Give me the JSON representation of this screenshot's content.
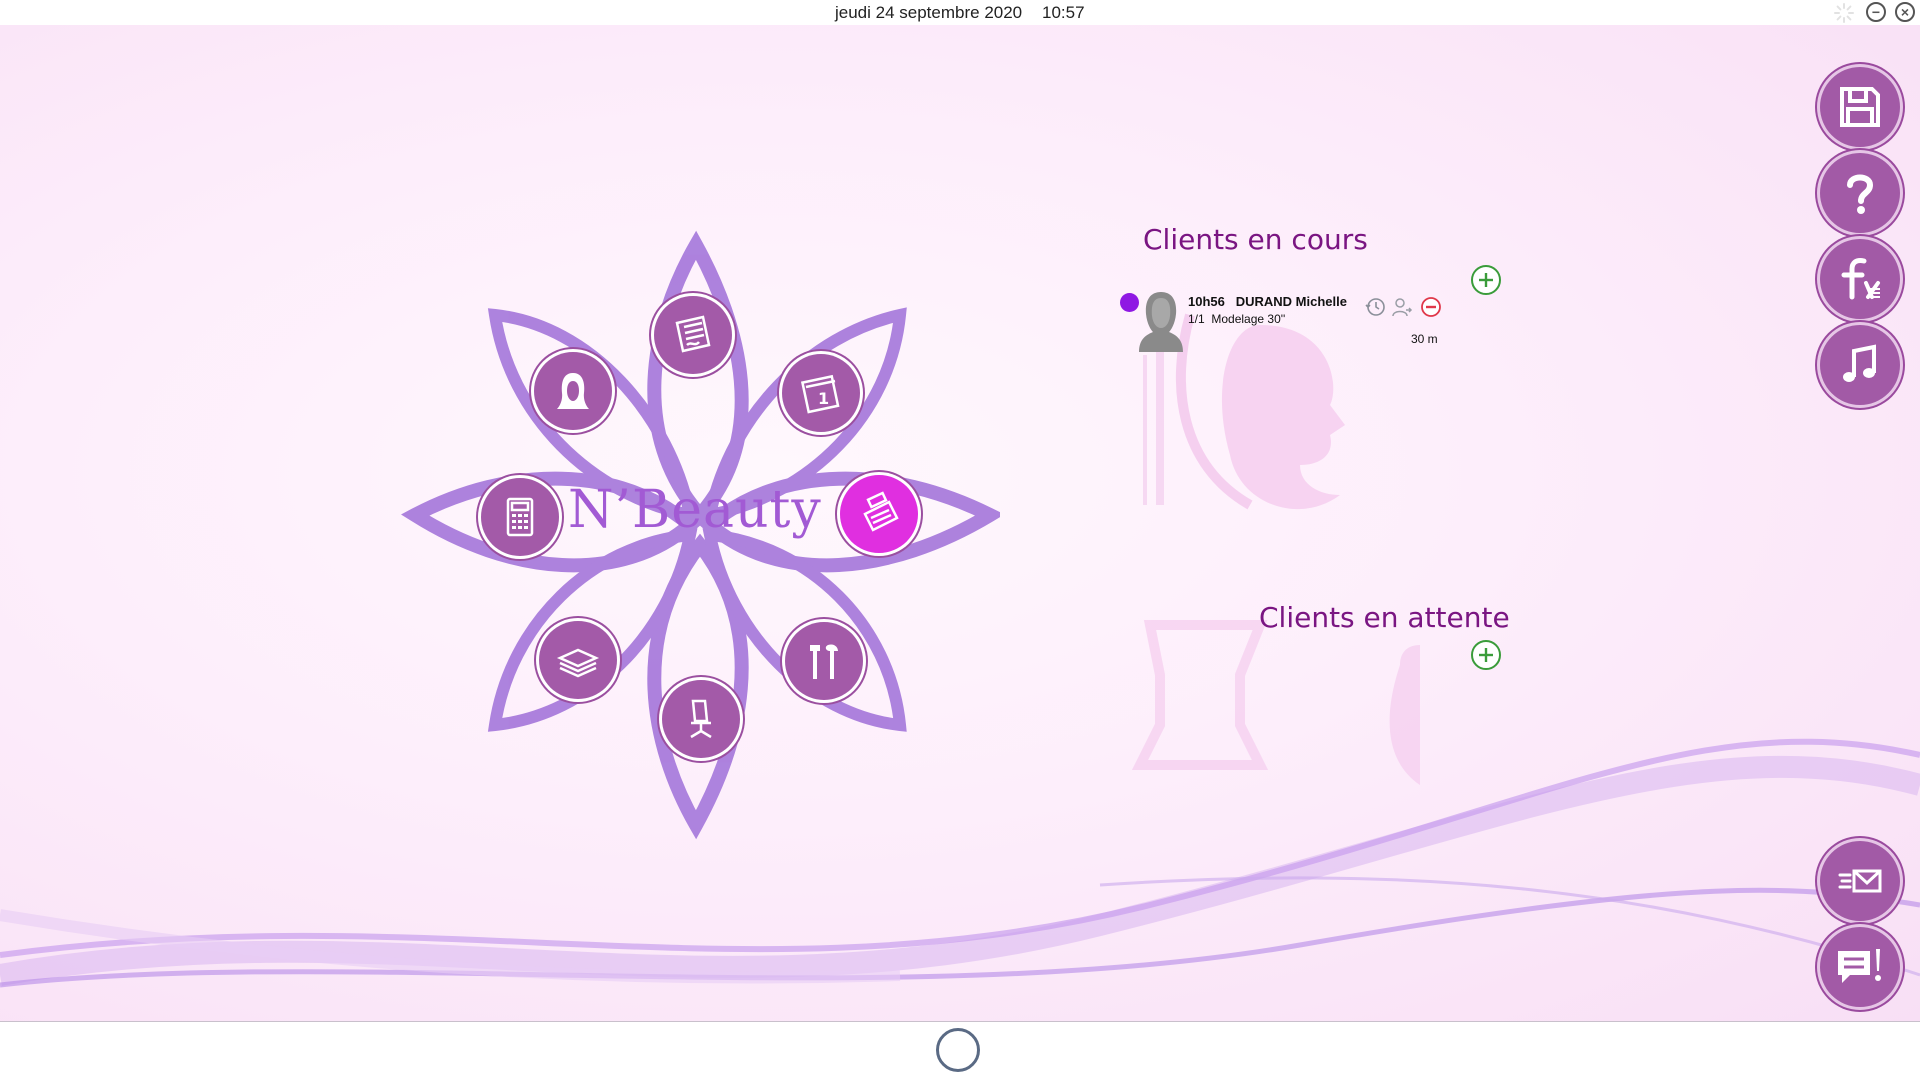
{
  "topbar": {
    "date": "jeudi 24 septembre 2020",
    "time": "10:57",
    "minimize_label": "−",
    "close_label": "×"
  },
  "app": {
    "logo_text": "N’Beauty"
  },
  "sections": {
    "current_title": "Clients en cours",
    "waiting_title": "Clients en attente"
  },
  "current_clients": [
    {
      "time": "10h56",
      "name": "DURAND Michelle",
      "count": "1/1",
      "service": "Modelage 30''",
      "duration": "30 m",
      "status_color": "#8f18e3"
    }
  ],
  "colors": {
    "accent": "#a25aa6",
    "title": "#7a1582",
    "active": "#e02fe0"
  },
  "menu_icons": [
    "woman-icon",
    "file-icon",
    "calendar-icon",
    "calculator-icon",
    "cash-register-icon",
    "money-icon",
    "tools-icon",
    "office-chair-icon"
  ],
  "side_icons": [
    "save-icon",
    "help-icon",
    "fidelity-icon",
    "music-icon",
    "email-icon",
    "chat-alert-icon"
  ]
}
